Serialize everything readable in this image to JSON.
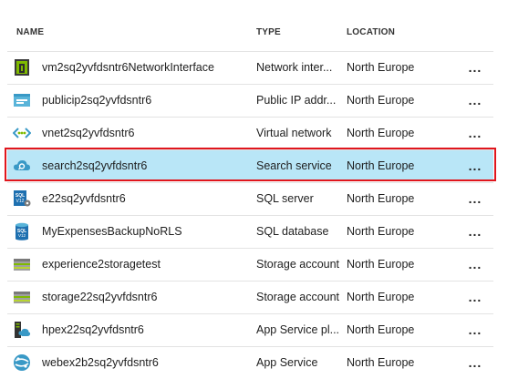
{
  "header": {
    "name": "NAME",
    "type": "TYPE",
    "location": "LOCATION"
  },
  "more_label": "...",
  "rows": [
    {
      "name": "vm2sq2yvfdsntr6NetworkInterface",
      "type": "Network inter...",
      "location": "North Europe",
      "icon": "network-interface-icon"
    },
    {
      "name": "publicip2sq2yvfdsntr6",
      "type": "Public IP addr...",
      "location": "North Europe",
      "icon": "public-ip-icon"
    },
    {
      "name": "vnet2sq2yvfdsntr6",
      "type": "Virtual network",
      "location": "North Europe",
      "icon": "virtual-network-icon"
    },
    {
      "name": "search2sq2yvfdsntr6",
      "type": "Search service",
      "location": "North Europe",
      "icon": "search-service-icon",
      "selected": true
    },
    {
      "name": "e22sq2yvfdsntr6",
      "type": "SQL server",
      "location": "North Europe",
      "icon": "sql-server-icon"
    },
    {
      "name": "MyExpensesBackupNoRLS",
      "type": "SQL database",
      "location": "North Europe",
      "icon": "sql-database-icon"
    },
    {
      "name": "experience2storagetest",
      "type": "Storage account",
      "location": "North Europe",
      "icon": "storage-account-icon"
    },
    {
      "name": "storage22sq2yvfdsntr6",
      "type": "Storage account",
      "location": "North Europe",
      "icon": "storage-account-icon"
    },
    {
      "name": "hpex22sq2yvfdsntr6",
      "type": "App Service pl...",
      "location": "North Europe",
      "icon": "app-service-plan-icon"
    },
    {
      "name": "webex2b2sq2yvfdsntr6",
      "type": "App Service",
      "location": "North Europe",
      "icon": "app-service-icon"
    }
  ],
  "colors": {
    "selected_row": "#b9e6f7",
    "highlight_border": "#e0161d"
  }
}
